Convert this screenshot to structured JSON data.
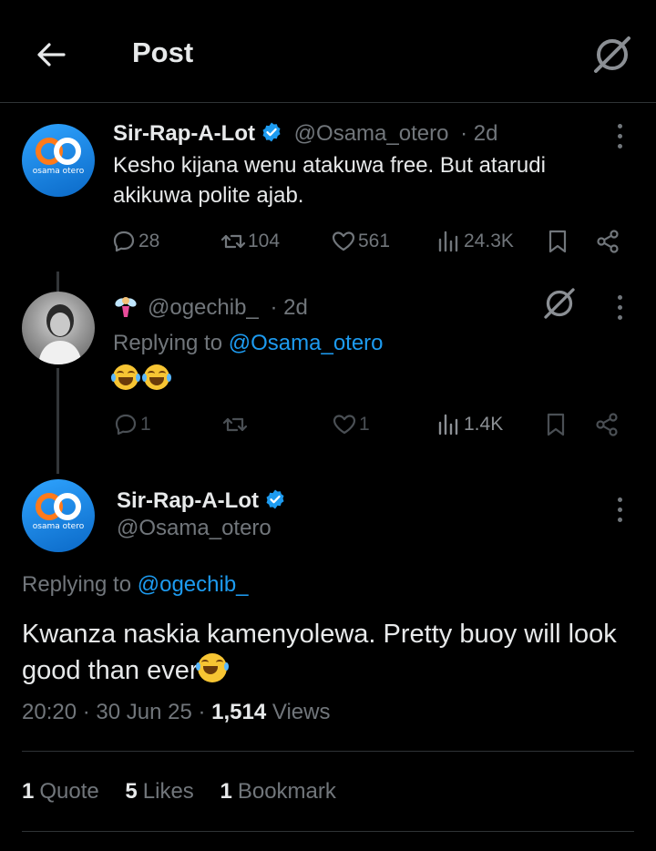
{
  "header": {
    "title": "Post"
  },
  "tweet1": {
    "name": "Sir-Rap-A-Lot",
    "handle": "@Osama_otero",
    "time": "· 2d",
    "text": "Kesho kijana wenu atakuwa free. But atarudi akikuwa polite ajab.",
    "avatar_label": "osama otero",
    "replies": "28",
    "reposts": "104",
    "likes": "561",
    "views": "24.3K"
  },
  "tweet2": {
    "handle": "@ogechib_",
    "time": "· 2d",
    "replying_prefix": "Replying to ",
    "replying_to": "@Osama_otero",
    "replies": "1",
    "likes": "1",
    "views": "1.4K"
  },
  "main": {
    "name": "Sir-Rap-A-Lot",
    "handle": "@Osama_otero",
    "avatar_label": "osama otero",
    "replying_prefix": "Replying to ",
    "replying_to": "@ogechib_",
    "text": "Kwanza naskia kamenyolewa. Pretty buoy will look good than ever",
    "time": "20:20 · 30 Jun 25 · ",
    "views_count": "1,514",
    "views_label": " Views",
    "quotes_count": "1",
    "quotes_label": "Quote",
    "likes_count": "5",
    "likes_label": "Likes",
    "bookmarks_count": "1",
    "bookmarks_label": "Bookmark"
  },
  "colors": {
    "accent": "#1d9bf0",
    "muted": "#71767b",
    "background": "#000000"
  }
}
